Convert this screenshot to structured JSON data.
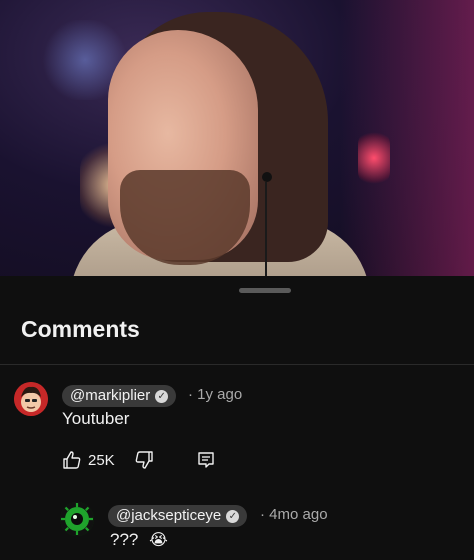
{
  "sheet": {
    "title": "Comments"
  },
  "comments": [
    {
      "handle": "@markiplier",
      "verified": true,
      "time": "· 1y ago",
      "text": "Youtuber",
      "likes": "25K",
      "avatar_icon": "markiplier-avatar-icon"
    }
  ],
  "replies": [
    {
      "handle": "@jacksepticeye",
      "verified": true,
      "time": "· 4mo ago",
      "text": "???",
      "emoji": "😭",
      "avatar_icon": "jacksepticeye-avatar-icon"
    }
  ],
  "colors": {
    "background": "#0f0f0f",
    "chip": "#3a3a3a",
    "meta_text": "#aaaaaa",
    "primary_text": "#f1f1f1"
  }
}
